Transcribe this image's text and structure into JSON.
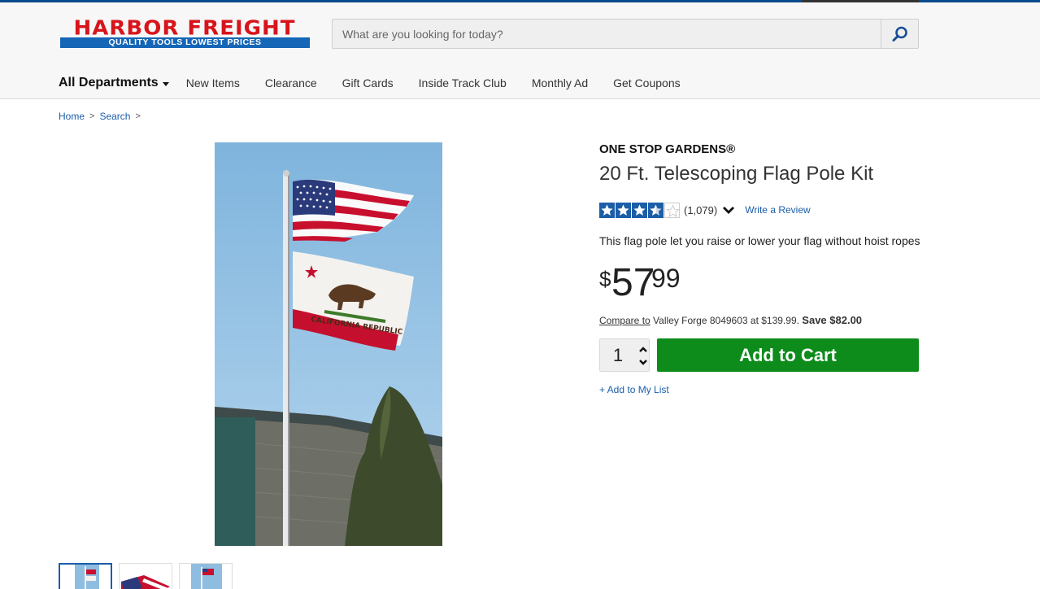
{
  "header": {
    "logo_brand": "HARBOR FREIGHT",
    "logo_tagline": "QUALITY TOOLS   LOWEST PRICES",
    "search_placeholder": "What are you looking for today?",
    "search_icon": "magnifier-icon"
  },
  "nav": {
    "departments": "All Departments",
    "items": [
      "New Items",
      "Clearance",
      "Gift Cards",
      "Inside Track Club",
      "Monthly Ad",
      "Get Coupons"
    ]
  },
  "breadcrumbs": [
    "Home",
    "Search"
  ],
  "product": {
    "brand": "ONE STOP GARDENS®",
    "title": "20 Ft. Telescoping Flag Pole Kit",
    "rating_stars": 3.5,
    "rating_max": 5,
    "review_count": "(1,079)",
    "write_review": "Write a Review",
    "description": "This flag pole let you raise or lower your flag without hoist ropes",
    "price_currency": "$",
    "price_dollars": "57",
    "price_cents": "99",
    "compare_link": "Compare to",
    "compare_text": " Valley Forge 8049603 at $139.99. ",
    "save_text": "Save $82.00",
    "quantity": "1",
    "add_to_cart": "Add to Cart",
    "add_to_list": "+ Add to My List"
  },
  "colors": {
    "brand_red": "#d8141b",
    "brand_blue": "#1566b7",
    "link_blue": "#1a5ea8",
    "cart_green": "#0d8c1b"
  }
}
